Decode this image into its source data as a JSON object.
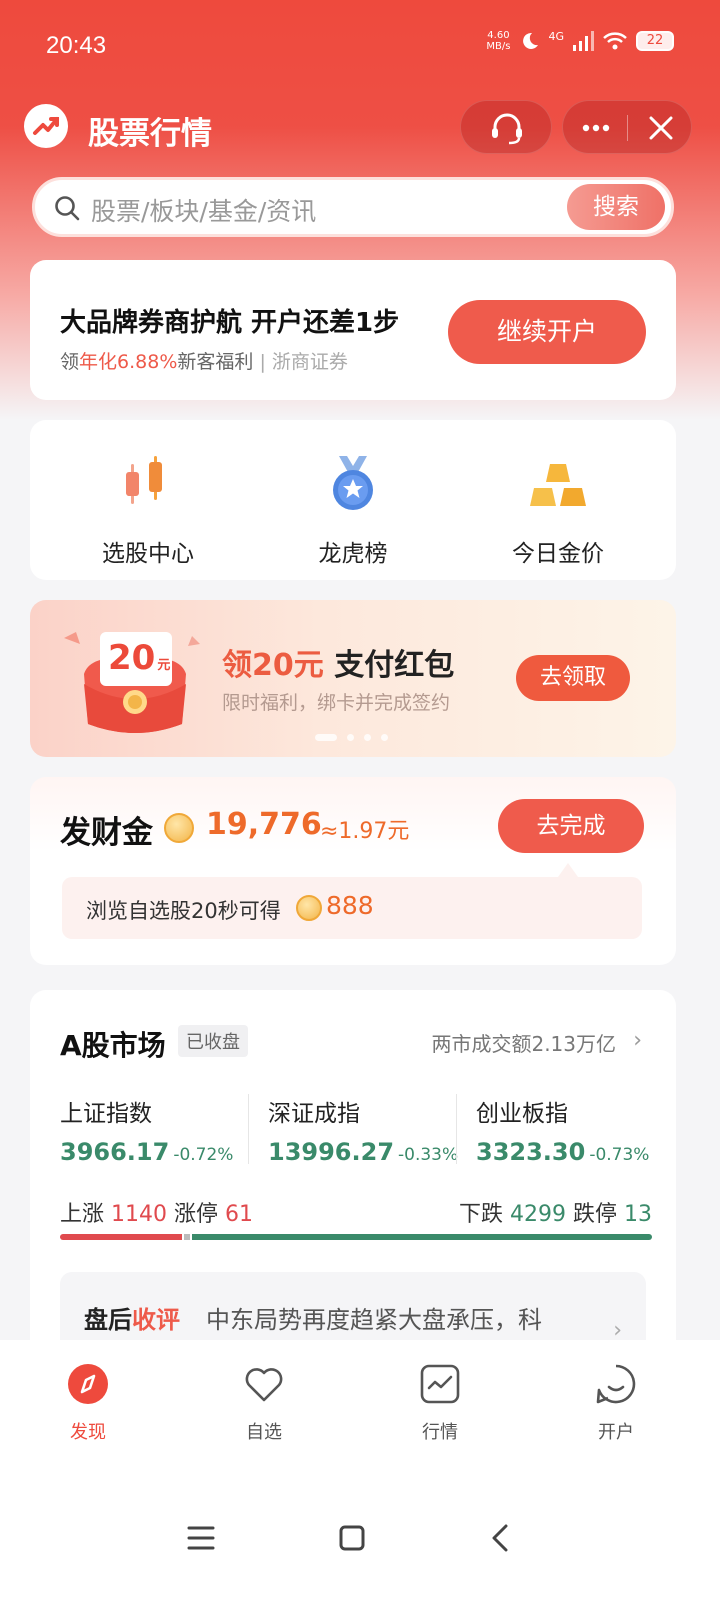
{
  "status": {
    "time": "20:43",
    "speed_top": "4.60",
    "speed_bottom": "MB/s",
    "network": "4G",
    "wifi_level": "6",
    "battery": "22"
  },
  "app": {
    "title": "股票行情"
  },
  "search": {
    "placeholder": "股票/板块/基金/资讯",
    "button": "搜索"
  },
  "account_card": {
    "title": "大品牌券商护航 开户还差1步",
    "sub_prefix": "领",
    "sub_highlight": "年化6.88%",
    "sub_suffix": "新客福利",
    "divider": "|",
    "broker": "浙商证券",
    "button": "继续开户"
  },
  "tools": [
    {
      "label": "选股中心",
      "icon": "candlestick-icon"
    },
    {
      "label": "龙虎榜",
      "icon": "medal-icon"
    },
    {
      "label": "今日金价",
      "icon": "gold-bars-icon"
    }
  ],
  "banner": {
    "amount": "20",
    "unit": "元",
    "title_highlight": "领20元",
    "title_rest": " 支付红包",
    "subtitle": "限时福利，绑卡并完成签约",
    "button": "去领取"
  },
  "fortune": {
    "label": "发财金",
    "coins": "19,776",
    "approx": "≈1.97元",
    "button": "去完成",
    "tip": "浏览自选股20秒可得",
    "tip_amount": "888"
  },
  "market": {
    "title": "A股市场",
    "status": "已收盘",
    "volume": "两市成交额2.13万亿",
    "indices": [
      {
        "name": "上证指数",
        "value": "3966.17",
        "change": "-0.72%"
      },
      {
        "name": "深证成指",
        "value": "13996.27",
        "change": "-0.33%"
      },
      {
        "name": "创业板指",
        "value": "3323.30",
        "change": "-0.73%"
      }
    ],
    "up_label": "上涨",
    "up": "1140",
    "limit_up_label": "涨停",
    "limit_up": "61",
    "down_label": "下跌",
    "down": "4299",
    "limit_down_label": "跌停",
    "limit_down": "13",
    "review_label": "盘后",
    "review_highlight": "收评",
    "review_text": "中东局势再度趋紧大盘承压，科"
  },
  "tabbar": [
    {
      "label": "发现",
      "icon": "compass-icon",
      "active": true
    },
    {
      "label": "自选",
      "icon": "heart-icon",
      "active": false
    },
    {
      "label": "行情",
      "icon": "chart-icon",
      "active": false
    },
    {
      "label": "开户",
      "icon": "smile-icon",
      "active": false
    }
  ],
  "colors": {
    "brand": "#ee4a3d",
    "up": "#e04a4e",
    "down": "#3a8a6a",
    "accent_orange": "#ee6a2a"
  }
}
